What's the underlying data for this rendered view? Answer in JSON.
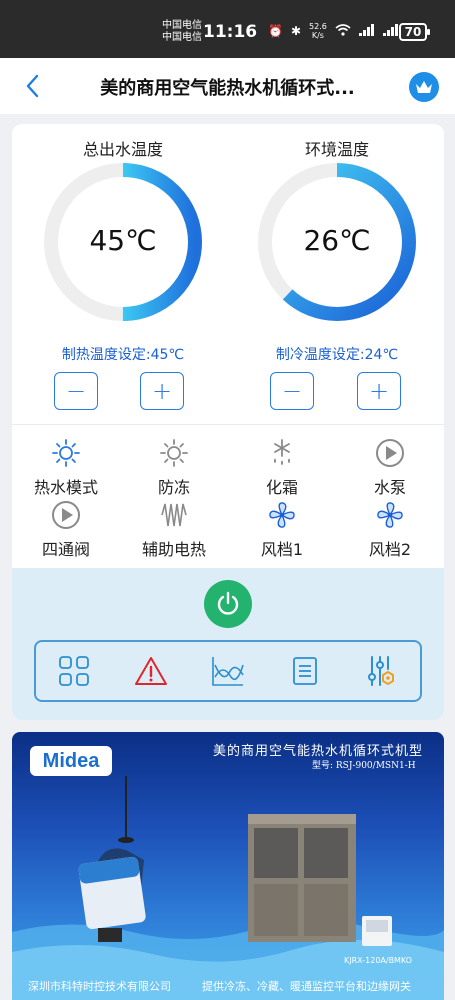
{
  "status_bar": {
    "carrier_1": "中国电信",
    "carrier_2": "中国电信",
    "time": "11:16",
    "net_speed_value": "52.6",
    "net_speed_unit": "K/s",
    "battery": "70"
  },
  "header": {
    "title": "美的商用空气能热水机循环式..."
  },
  "gauges": {
    "outlet": {
      "title": "总出水温度",
      "value": "45℃",
      "fill_fraction": 0.5
    },
    "ambient": {
      "title": "环境温度",
      "value": "26℃",
      "fill_fraction": 0.62
    }
  },
  "settings": {
    "heating_label": "制热温度设定:45℃",
    "cooling_label": "制冷温度设定:24℃",
    "minus": "−",
    "plus": "+"
  },
  "status_items": [
    {
      "label": "热水模式",
      "icon": "sun-icon"
    },
    {
      "label": "防冻",
      "icon": "sun-icon"
    },
    {
      "label": "化霜",
      "icon": "defrost-icon"
    },
    {
      "label": "水泵",
      "icon": "play-icon"
    },
    {
      "label": "四通阀",
      "icon": "play-icon"
    },
    {
      "label": "辅助电热",
      "icon": "heater-icon"
    },
    {
      "label": "风档1",
      "icon": "fan-icon"
    },
    {
      "label": "风档2",
      "icon": "fan-icon"
    }
  ],
  "toolbar": {
    "icons": [
      "grid-icon",
      "warning-icon",
      "chart-icon",
      "list-icon",
      "settings-sliders-icon"
    ]
  },
  "banner": {
    "brand": "Midea",
    "headline": "美的商用空气能热水机循环式机型",
    "model": "型号: RSJ-900/MSN1-H",
    "code": "KJRX-120A/BMKO",
    "footer_left": "深圳市科特时控技术有限公司",
    "footer_right": "提供冷冻、冷藏、暖通监控平台和边缘网关"
  },
  "colors": {
    "accent_blue": "#2b7ae0",
    "power_green": "#23b36e",
    "gauge_track": "#eeeeee"
  }
}
